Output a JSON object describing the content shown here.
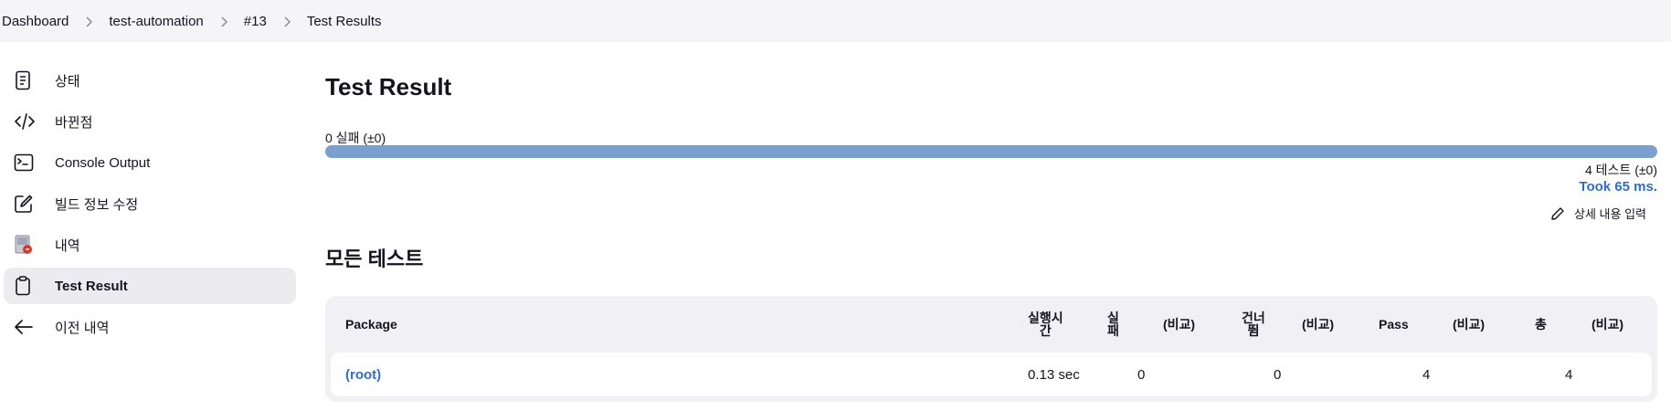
{
  "breadcrumb": [
    "Dashboard",
    "test-automation",
    "#13",
    "Test Results"
  ],
  "sidebar": {
    "items": [
      {
        "label": "상태",
        "icon": "document-icon",
        "active": false
      },
      {
        "label": "바뀐점",
        "icon": "code-icon",
        "active": false
      },
      {
        "label": "Console Output",
        "icon": "terminal-icon",
        "active": false
      },
      {
        "label": "빌드 정보 수정",
        "icon": "edit-square-icon",
        "active": false
      },
      {
        "label": "내역",
        "icon": "history-icon",
        "active": false
      },
      {
        "label": "Test Result",
        "icon": "clipboard-icon",
        "active": true
      },
      {
        "label": "이전 내역",
        "icon": "arrow-left-icon",
        "active": false
      }
    ]
  },
  "main": {
    "title": "Test Result",
    "fail_summary": "0 실패 (±0)",
    "progress_pass_fraction": 1.0,
    "tests_summary": "4 테스트 (±0)",
    "took": "Took 65 ms.",
    "edit_label": "상세 내용 입력",
    "section_title": "모든 테스트"
  },
  "table": {
    "headers": {
      "package": "Package",
      "duration_1": "실행시",
      "duration_2": "간",
      "fail_1": "실",
      "fail_2": "패",
      "fail_diff": "(비교)",
      "skip_1": "건너",
      "skip_2": "뜀",
      "skip_diff": "(비교)",
      "pass": "Pass",
      "pass_diff": "(비교)",
      "total": "총",
      "total_diff": "(비교)"
    },
    "rows": [
      {
        "package": "(root)",
        "duration": "0.13 sec",
        "fail": "0",
        "fail_diff": "",
        "skip": "0",
        "skip_diff": "",
        "pass": "4",
        "pass_diff": "",
        "total": "4",
        "total_diff": ""
      }
    ]
  },
  "colors": {
    "accent_link": "#2f6bd0",
    "progress_pass": "#7b9fd0",
    "breadcrumb_bg": "#f5f5f7",
    "active_item_bg": "#ebebf0"
  }
}
